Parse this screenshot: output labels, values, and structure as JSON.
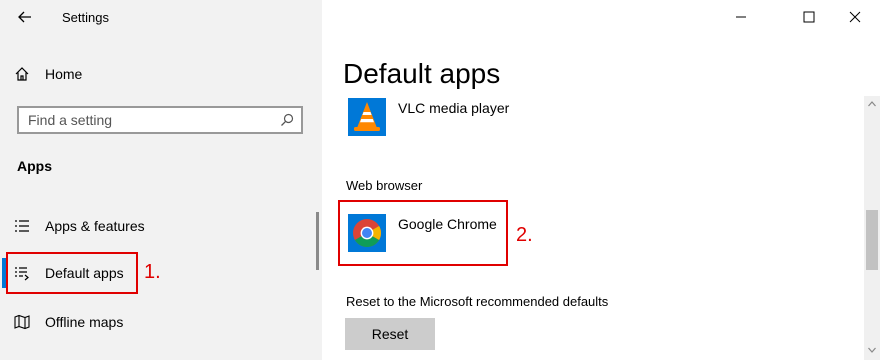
{
  "window": {
    "title": "Settings"
  },
  "sidebar": {
    "home_label": "Home",
    "search_placeholder": "Find a setting",
    "section_title": "Apps",
    "items": [
      {
        "label": "Apps & features",
        "icon": "list-icon"
      },
      {
        "label": "Default apps",
        "icon": "default-apps-icon",
        "active": true
      },
      {
        "label": "Offline maps",
        "icon": "map-icon"
      }
    ]
  },
  "main": {
    "title": "Default apps",
    "video_player": {
      "app_name": "VLC media player",
      "icon": "vlc-icon"
    },
    "web_browser": {
      "heading": "Web browser",
      "app_name": "Google Chrome",
      "icon": "chrome-icon"
    },
    "reset": {
      "caption": "Reset to the Microsoft recommended defaults",
      "button_label": "Reset"
    }
  },
  "annotations": {
    "step1": "1.",
    "step2": "2.",
    "color": "#e00000"
  },
  "colors": {
    "accent": "#0078d7",
    "sidebar_bg": "#f2f2f2"
  }
}
